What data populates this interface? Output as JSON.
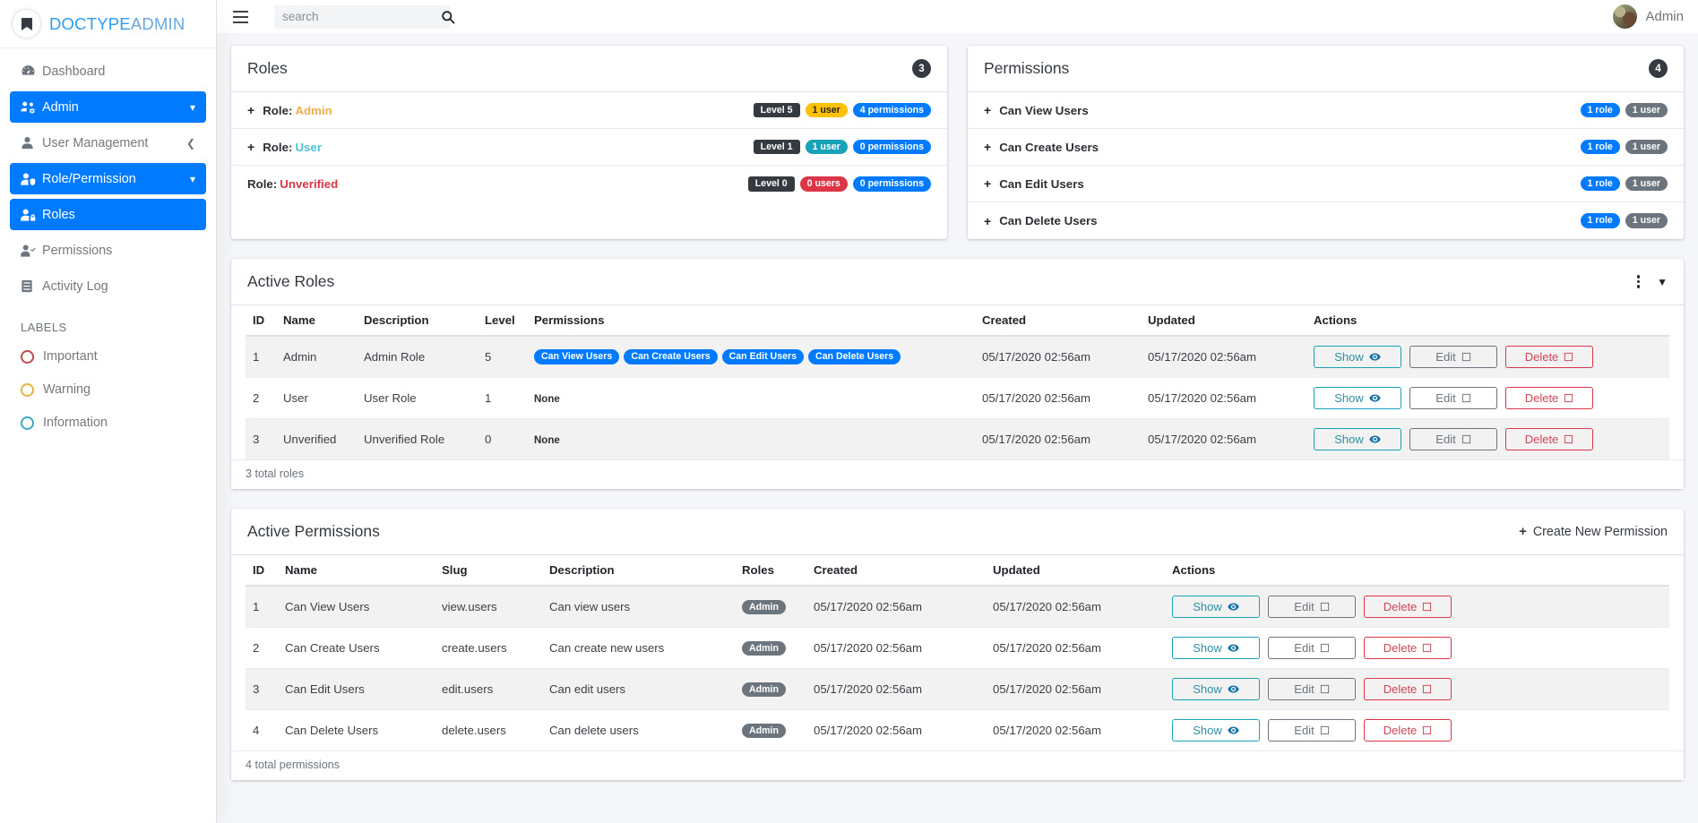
{
  "brand": {
    "part1": "DOCTYPE",
    "part2": "ADMIN",
    "logo_icon": "doctype-logo-icon"
  },
  "topbar": {
    "menu_icon": "hamburger-icon",
    "search": {
      "placeholder": "search",
      "value": "",
      "icon": "search-icon"
    },
    "user": {
      "name": "Admin",
      "avatar_icon": "user-avatar"
    }
  },
  "sidebar": {
    "items": [
      {
        "label": "Dashboard",
        "icon": "dashboard-icon",
        "active": false,
        "caret": ""
      },
      {
        "label": "Admin",
        "icon": "users-cog-icon",
        "active": true,
        "caret": "chevron-down-icon"
      },
      {
        "label": "User Management",
        "icon": "user-icon",
        "active": false,
        "caret": "chevron-left-icon"
      },
      {
        "label": "Role/Permission",
        "icon": "user-shield-icon",
        "active": true,
        "caret": "chevron-down-icon"
      },
      {
        "label": "Roles",
        "icon": "user-lock-icon",
        "active": true,
        "caret": ""
      },
      {
        "label": "Permissions",
        "icon": "user-check-icon",
        "active": false,
        "caret": ""
      },
      {
        "label": "Activity Log",
        "icon": "log-icon",
        "active": false,
        "caret": ""
      }
    ],
    "labels_heading": "LABELS",
    "labels": [
      {
        "label": "Important",
        "color": "#c04a4a"
      },
      {
        "label": "Warning",
        "color": "#e7b53f"
      },
      {
        "label": "Information",
        "color": "#3ba7c4"
      }
    ]
  },
  "roles_card": {
    "title": "Roles",
    "count": "3",
    "prefix": "Role:",
    "rows": [
      {
        "has_plus": true,
        "plus": "+",
        "name": "Admin",
        "name_color": "#f0ad4e",
        "badges": [
          {
            "text": "Level 5",
            "style": "b-dark sq"
          },
          {
            "text": "1 user",
            "style": "b-warning"
          },
          {
            "text": "4 permissions",
            "style": "b-primary"
          }
        ]
      },
      {
        "has_plus": true,
        "plus": "+",
        "name": "User",
        "name_color": "#4dc3d6",
        "badges": [
          {
            "text": "Level 1",
            "style": "b-dark sq"
          },
          {
            "text": "1 user",
            "style": "b-info"
          },
          {
            "text": "0 permissions",
            "style": "b-primary"
          }
        ]
      },
      {
        "has_plus": false,
        "plus": "",
        "name": "Unverified",
        "name_color": "#dc3545",
        "badges": [
          {
            "text": "Level 0",
            "style": "b-dark sq"
          },
          {
            "text": "0 users",
            "style": "b-danger"
          },
          {
            "text": "0 permissions",
            "style": "b-primary"
          }
        ]
      }
    ]
  },
  "permissions_card": {
    "title": "Permissions",
    "count": "4",
    "rows": [
      {
        "plus": "+",
        "name": "Can View Users",
        "badges": [
          {
            "text": "1 role",
            "style": "b-primary"
          },
          {
            "text": "1 user",
            "style": "b-secondary"
          }
        ]
      },
      {
        "plus": "+",
        "name": "Can Create Users",
        "badges": [
          {
            "text": "1 role",
            "style": "b-primary"
          },
          {
            "text": "1 user",
            "style": "b-secondary"
          }
        ]
      },
      {
        "plus": "+",
        "name": "Can Edit Users",
        "badges": [
          {
            "text": "1 role",
            "style": "b-primary"
          },
          {
            "text": "1 user",
            "style": "b-secondary"
          }
        ]
      },
      {
        "plus": "+",
        "name": "Can Delete Users",
        "badges": [
          {
            "text": "1 role",
            "style": "b-primary"
          },
          {
            "text": "1 user",
            "style": "b-secondary"
          }
        ]
      }
    ]
  },
  "active_roles": {
    "title": "Active Roles",
    "menu_icon": "kebab-menu-icon",
    "caret_icon": "caret-down-icon",
    "columns": [
      "ID",
      "Name",
      "Description",
      "Level",
      "Permissions",
      "Created",
      "Updated",
      "Actions"
    ],
    "rows": [
      {
        "id": "1",
        "name": "Admin",
        "description": "Admin Role",
        "level": "5",
        "permissions": [
          "Can View Users",
          "Can Create Users",
          "Can Edit Users",
          "Can Delete Users"
        ],
        "permissions_none": "",
        "created": "05/17/2020 02:56am",
        "updated": "05/17/2020 02:56am"
      },
      {
        "id": "2",
        "name": "User",
        "description": "User Role",
        "level": "1",
        "permissions": [],
        "permissions_none": "None",
        "created": "05/17/2020 02:56am",
        "updated": "05/17/2020 02:56am"
      },
      {
        "id": "3",
        "name": "Unverified",
        "description": "Unverified Role",
        "level": "0",
        "permissions": [],
        "permissions_none": "None",
        "created": "05/17/2020 02:56am",
        "updated": "05/17/2020 02:56am"
      }
    ],
    "actions": {
      "show": "Show",
      "edit": "Edit",
      "delete": "Delete"
    },
    "footer": "3 total roles"
  },
  "active_permissions": {
    "title": "Active Permissions",
    "create_label": "Create New Permission",
    "create_plus": "+",
    "columns": [
      "ID",
      "Name",
      "Slug",
      "Description",
      "Roles",
      "Created",
      "Updated",
      "Actions"
    ],
    "rows": [
      {
        "id": "1",
        "name": "Can View Users",
        "slug": "view.users",
        "description": "Can view users",
        "roles": [
          "Admin"
        ],
        "created": "05/17/2020 02:56am",
        "updated": "05/17/2020 02:56am"
      },
      {
        "id": "2",
        "name": "Can Create Users",
        "slug": "create.users",
        "description": "Can create new users",
        "roles": [
          "Admin"
        ],
        "created": "05/17/2020 02:56am",
        "updated": "05/17/2020 02:56am"
      },
      {
        "id": "3",
        "name": "Can Edit Users",
        "slug": "edit.users",
        "description": "Can edit users",
        "roles": [
          "Admin"
        ],
        "created": "05/17/2020 02:56am",
        "updated": "05/17/2020 02:56am"
      },
      {
        "id": "4",
        "name": "Can Delete Users",
        "slug": "delete.users",
        "description": "Can delete users",
        "roles": [
          "Admin"
        ],
        "created": "05/17/2020 02:56am",
        "updated": "05/17/2020 02:56am"
      }
    ],
    "actions": {
      "show": "Show",
      "edit": "Edit",
      "delete": "Delete"
    },
    "footer": "4 total permissions"
  },
  "icons": {
    "eye": "eye-icon",
    "pencil": "pencil-icon",
    "trash": "trash-icon"
  }
}
